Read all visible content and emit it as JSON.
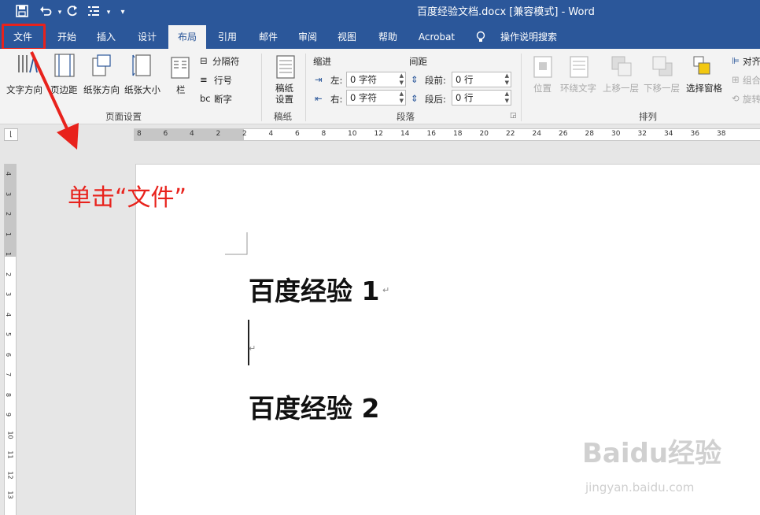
{
  "titlebar": {
    "doc_title": "百度经验文档.docx [兼容模式]  -  Word",
    "save_icon": "save-icon",
    "undo_icon": "undo-icon",
    "redo_icon": "redo-icon",
    "list_icon": "list-icon",
    "customize_icon": "dropdown-icon"
  },
  "tabs": [
    {
      "label": "文件",
      "active": false
    },
    {
      "label": "开始",
      "active": false
    },
    {
      "label": "插入",
      "active": false
    },
    {
      "label": "设计",
      "active": false
    },
    {
      "label": "布局",
      "active": true
    },
    {
      "label": "引用",
      "active": false
    },
    {
      "label": "邮件",
      "active": false
    },
    {
      "label": "审阅",
      "active": false
    },
    {
      "label": "视图",
      "active": false
    },
    {
      "label": "帮助",
      "active": false
    },
    {
      "label": "Acrobat",
      "active": false
    }
  ],
  "tell_me": "操作说明搜索",
  "ribbon": {
    "page_setup": {
      "text_direction": "文字方向",
      "margins": "页边距",
      "orientation": "纸张方向",
      "size": "纸张大小",
      "columns": "栏",
      "breaks": "分隔符",
      "line_numbers": "行号",
      "hyphenation": "断字",
      "group_label": "页面设置"
    },
    "manuscript": {
      "button_line1": "稿纸",
      "button_line2": "设置",
      "group_label": "稿纸"
    },
    "paragraph": {
      "indent_title": "缩进",
      "spacing_title": "间距",
      "left_label": "左:",
      "left_value": "0 字符",
      "right_label": "右:",
      "right_value": "0 字符",
      "before_label": "段前:",
      "before_value": "0 行",
      "after_label": "段后:",
      "after_value": "0 行",
      "group_label": "段落"
    },
    "arrange": {
      "position": "位置",
      "wrap_text": "环绕文字",
      "bring_forward": "上移一层",
      "send_backward": "下移一层",
      "selection_pane": "选择窗格",
      "align": "对齐",
      "group": "组合",
      "rotate": "旋转",
      "group_label": "排列"
    }
  },
  "ruler": {
    "h_numbers": [
      "8",
      "6",
      "4",
      "2",
      "2",
      "4",
      "6",
      "8",
      "10",
      "12",
      "14",
      "16",
      "18",
      "20",
      "22",
      "24",
      "26",
      "28",
      "30",
      "32",
      "34",
      "36",
      "38"
    ],
    "v_numbers": [
      "4",
      "3",
      "2",
      "1",
      "1",
      "2",
      "3",
      "4",
      "5",
      "6",
      "7",
      "8",
      "9",
      "10",
      "11",
      "12",
      "13"
    ]
  },
  "document": {
    "heading1": "百度经验 1",
    "heading2": "百度经验 2",
    "para_mark": "↵"
  },
  "annotation": "单击“文件”",
  "watermark": {
    "brand": "Baidu经验",
    "url": "jingyan.baidu.com"
  },
  "colors": {
    "title_bar": "#2b579a",
    "highlight": "#e8221c"
  }
}
